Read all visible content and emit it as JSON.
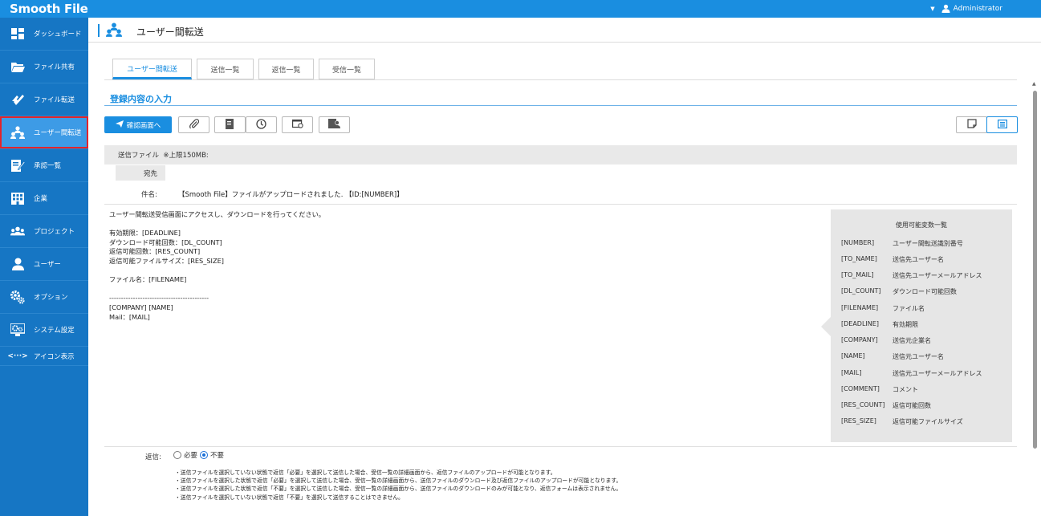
{
  "app": {
    "logo": "Smooth File",
    "user": "Administrator"
  },
  "sidebar": {
    "items": [
      {
        "label": "ダッシュボード",
        "icon": "dashboard-icon"
      },
      {
        "label": "ファイル共有",
        "icon": "folder-icon"
      },
      {
        "label": "ファイル転送",
        "icon": "transfer-icon"
      },
      {
        "label": "ユーザー間転送",
        "icon": "user-transfer-icon",
        "active": true
      },
      {
        "label": "承認一覧",
        "icon": "approval-icon"
      },
      {
        "label": "企業",
        "icon": "company-icon"
      },
      {
        "label": "プロジェクト",
        "icon": "project-icon"
      },
      {
        "label": "ユーザー",
        "icon": "user-icon"
      },
      {
        "label": "オプション",
        "icon": "options-icon"
      },
      {
        "label": "システム設定",
        "icon": "system-settings-icon"
      }
    ],
    "toggle": {
      "symbol": "<···>",
      "label": "アイコン表示"
    }
  },
  "header": {
    "title": "ユーザー間転送"
  },
  "tabs": [
    {
      "label": "ユーザー間転送",
      "active": true
    },
    {
      "label": "送信一覧"
    },
    {
      "label": "返信一覧"
    },
    {
      "label": "受信一覧"
    }
  ],
  "section": {
    "title": "登録内容の入力"
  },
  "toolbar": {
    "confirm_label": "確認画面へ"
  },
  "form": {
    "send_file_label": "送信ファイル",
    "send_file_note": "※上限150MB:",
    "destination_label": "宛先",
    "subject_label": "件名:",
    "subject_value": "【Smooth File】ファイルがアップロードされました. 【ID:[NUMBER]】",
    "body": "ユーザー間転送受信画面にアクセスし、ダウンロードを行ってください。\n\n有効期限：[DEADLINE]\nダウンロード可能回数：[DL_COUNT]\n返信可能回数：[RES_COUNT]\n返信可能ファイルサイズ：[RES_SIZE]\n\nファイル名：[FILENAME]\n\n------------------------------------------\n[COMPANY] [NAME]\nMail：[MAIL]"
  },
  "variables": {
    "title": "使用可能変数一覧",
    "rows": [
      {
        "key": "[NUMBER]",
        "desc": "ユーザー間転送識別番号"
      },
      {
        "key": "[TO_NAME]",
        "desc": "送信先ユーザー名"
      },
      {
        "key": "[TO_MAIL]",
        "desc": "送信先ユーザーメールアドレス"
      },
      {
        "key": "[DL_COUNT]",
        "desc": "ダウンロード可能回数"
      },
      {
        "key": "[FILENAME]",
        "desc": "ファイル名"
      },
      {
        "key": "[DEADLINE]",
        "desc": "有効期限"
      },
      {
        "key": "[COMPANY]",
        "desc": "送信元企業名"
      },
      {
        "key": "[NAME]",
        "desc": "送信元ユーザー名"
      },
      {
        "key": "[MAIL]",
        "desc": "送信元ユーザーメールアドレス"
      },
      {
        "key": "[COMMENT]",
        "desc": "コメント"
      },
      {
        "key": "[RES_COUNT]",
        "desc": "返信可能回数"
      },
      {
        "key": "[RES_SIZE]",
        "desc": "返信可能ファイルサイズ"
      }
    ]
  },
  "reply": {
    "label": "返信:",
    "options": [
      {
        "label": "必要",
        "checked": false
      },
      {
        "label": "不要",
        "checked": true
      }
    ],
    "notes": [
      "・送信ファイルを選択していない状態で返信「必要」を選択して送信した場合、受信一覧の詳細画面から、返信ファイルのアップロードが可能となります。",
      "・送信ファイルを選択した状態で返信「必要」を選択して送信した場合、受信一覧の詳細画面から、送信ファイルのダウンロード及び返信ファイルのアップロードが可能となります。",
      "・送信ファイルを選択した状態で返信「不要」を選択して送信した場合、受信一覧の詳細画面から、送信ファイルのダウンロードのみが可能となり、返信フォームは表示されません。",
      "・送信ファイルを選択していない状態で返信「不要」を選択して送信することはできません。"
    ]
  },
  "colors": {
    "topbar": "#1a8ee0",
    "sidebar": "#1676c4",
    "accent": "#1a8ee0",
    "highlight": "#e3242b"
  }
}
